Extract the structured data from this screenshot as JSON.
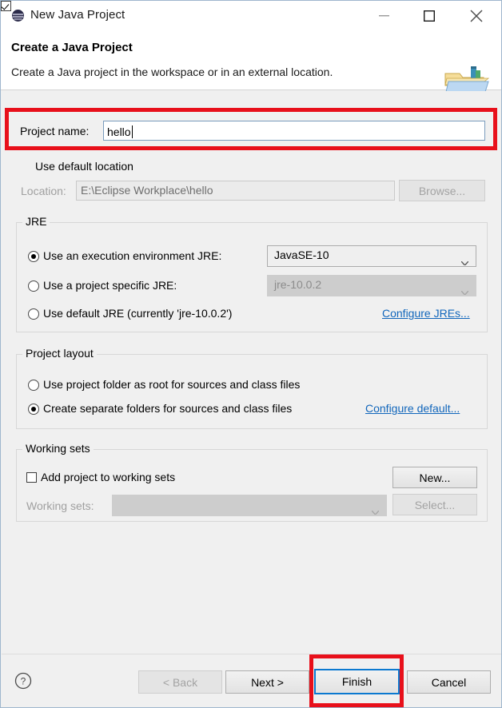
{
  "window": {
    "title": "New Java Project",
    "icon": "eclipse-icon",
    "minimize_label": "Minimize",
    "maximize_label": "Maximize",
    "close_label": "Close"
  },
  "banner": {
    "title": "Create a Java Project",
    "description": "Create a Java project in the workspace or in an external location.",
    "icon": "java-project-folder-icon"
  },
  "project_name": {
    "label": "Project name:",
    "value": "hello",
    "placeholder": ""
  },
  "location": {
    "checkbox_label": "Use default location",
    "checked": true,
    "label": "Location:",
    "value": "E:\\Eclipse Workplace\\hello",
    "browse_label": "Browse..."
  },
  "jre": {
    "group_title": "JRE",
    "options": [
      {
        "label": "Use an execution environment JRE:",
        "selected": true
      },
      {
        "label": "Use a project specific JRE:",
        "selected": false
      },
      {
        "label": "Use default JRE (currently 'jre-10.0.2')",
        "selected": false
      }
    ],
    "execution_environment_value": "JavaSE-10",
    "project_specific_value": "jre-10.0.2",
    "configure_link": "Configure JREs..."
  },
  "project_layout": {
    "group_title": "Project layout",
    "options": [
      {
        "label": "Use project folder as root for sources and class files",
        "selected": false
      },
      {
        "label": "Create separate folders for sources and class files",
        "selected": true
      }
    ],
    "configure_link": "Configure default..."
  },
  "working_sets": {
    "group_title": "Working sets",
    "checkbox_label": "Add project to working sets",
    "checked": false,
    "new_label": "New...",
    "label": "Working sets:",
    "value": "",
    "select_label": "Select..."
  },
  "footer": {
    "help_icon": "help-icon",
    "back_label": "< Back",
    "next_label": "Next >",
    "finish_label": "Finish",
    "cancel_label": "Cancel"
  },
  "annotations": {
    "highlight_color": "#e8101b",
    "focus_color": "#0b79d0",
    "boxes": [
      "project-name-row",
      "finish-button"
    ]
  }
}
